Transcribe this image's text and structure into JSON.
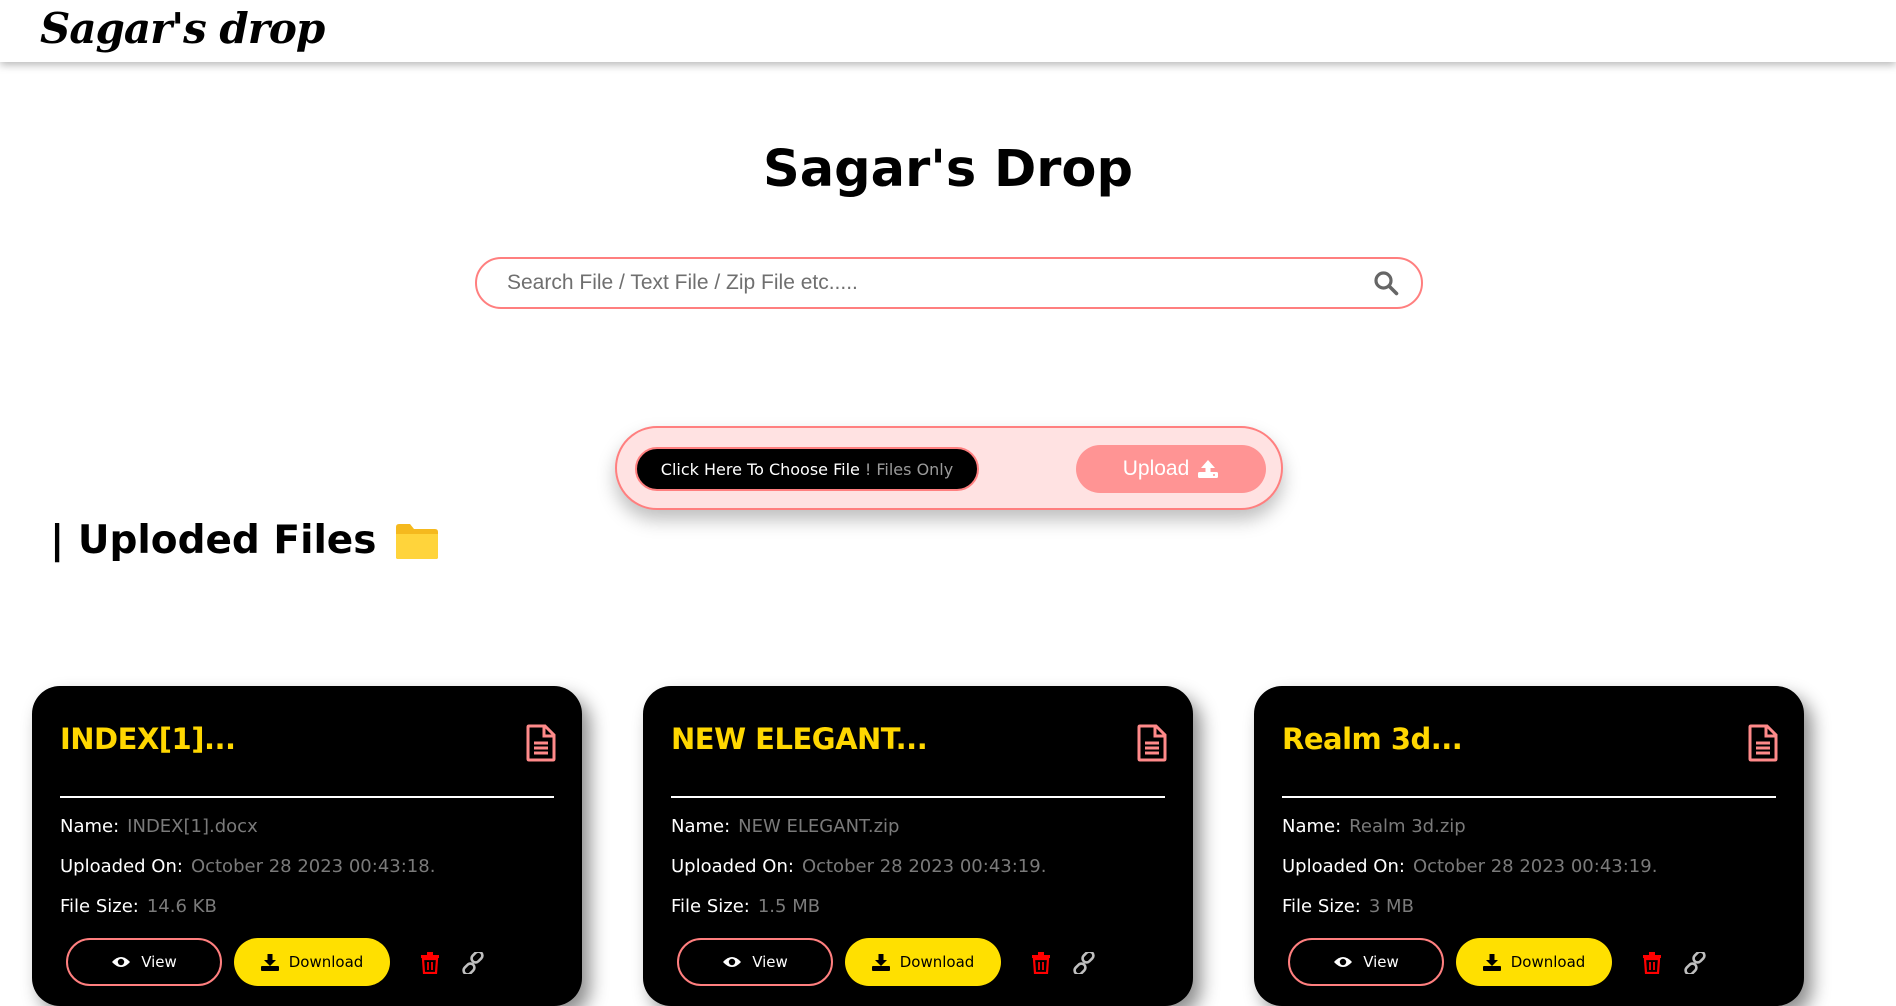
{
  "navbar": {
    "brand": "Sagar's drop"
  },
  "header": {
    "title": "Sagar's Drop"
  },
  "search": {
    "placeholder": "Search File / Text File / Zip File etc....."
  },
  "upload": {
    "choose_label": "Click Here To Choose File",
    "choose_hint": "! Files Only",
    "upload_label": "Upload"
  },
  "section": {
    "title": "| Uploded Files"
  },
  "labels": {
    "name": "Name:",
    "uploaded_on": "Uploaded On:",
    "file_size": "File Size:",
    "view": "View",
    "download": "Download"
  },
  "files": [
    {
      "title": "INDEX[1]...",
      "name": "INDEX[1].docx",
      "uploaded_on": "October 28 2023 00:43:18.",
      "size": "14.6 KB"
    },
    {
      "title": "NEW ELEGANT...",
      "name": "NEW ELEGANT.zip",
      "uploaded_on": "October 28 2023 00:43:19.",
      "size": "1.5 MB"
    },
    {
      "title": "Realm 3d...",
      "name": "Realm 3d.zip",
      "uploaded_on": "October 28 2023 00:43:19.",
      "size": "3 MB"
    }
  ],
  "colors": {
    "accent_pink": "#ff7f7f",
    "upload_button": "#ff9494",
    "card_title": "#ffd700",
    "download_button": "#ffe000",
    "trash": "#ff0000"
  },
  "icons": [
    "search-icon",
    "upload-icon",
    "folder-icon",
    "document-icon",
    "eye-icon",
    "download-icon",
    "trash-icon",
    "link-icon"
  ]
}
